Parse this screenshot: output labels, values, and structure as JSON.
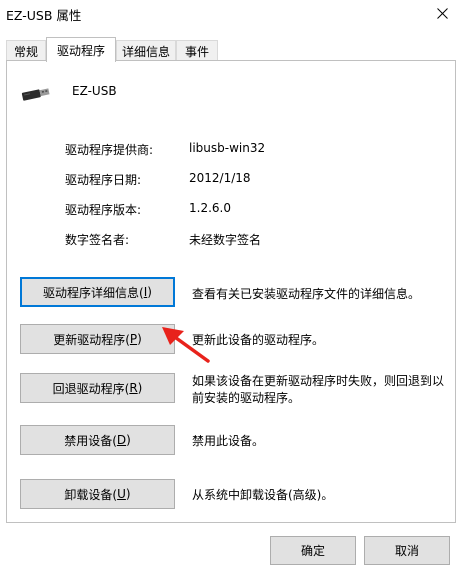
{
  "window": {
    "title": "EZ-USB 属性"
  },
  "tabs": [
    {
      "label": "常规"
    },
    {
      "label": "驱动程序"
    },
    {
      "label": "详细信息"
    },
    {
      "label": "事件"
    }
  ],
  "device": {
    "name": "EZ-USB",
    "icon": "usb-drive-icon"
  },
  "info": [
    {
      "label": "驱动程序提供商:",
      "value": "libusb-win32"
    },
    {
      "label": "驱动程序日期:",
      "value": "2012/1/18"
    },
    {
      "label": "驱动程序版本:",
      "value": "1.2.6.0"
    },
    {
      "label": "数字签名者:",
      "value": "未经数字签名"
    }
  ],
  "actions": [
    {
      "label": "驱动程序详细信息(",
      "key": "I",
      "close": ")",
      "desc": "查看有关已安装驱动程序文件的详细信息。"
    },
    {
      "label": "更新驱动程序(",
      "key": "P",
      "close": ")",
      "desc": "更新此设备的驱动程序。"
    },
    {
      "label": "回退驱动程序(",
      "key": "R",
      "close": ")",
      "desc": "如果该设备在更新驱动程序时失败，则回退到以前安装的驱动程序。"
    },
    {
      "label": "禁用设备(",
      "key": "D",
      "close": ")",
      "desc": "禁用此设备。"
    },
    {
      "label": "卸载设备(",
      "key": "U",
      "close": ")",
      "desc": "从系统中卸载设备(高级)。"
    }
  ],
  "footer": {
    "ok_label": "确定",
    "cancel_label": "取消"
  },
  "colors": {
    "accent": "#0078d7",
    "annotation_arrow": "#e8221b",
    "button_face": "#e1e1e1"
  }
}
